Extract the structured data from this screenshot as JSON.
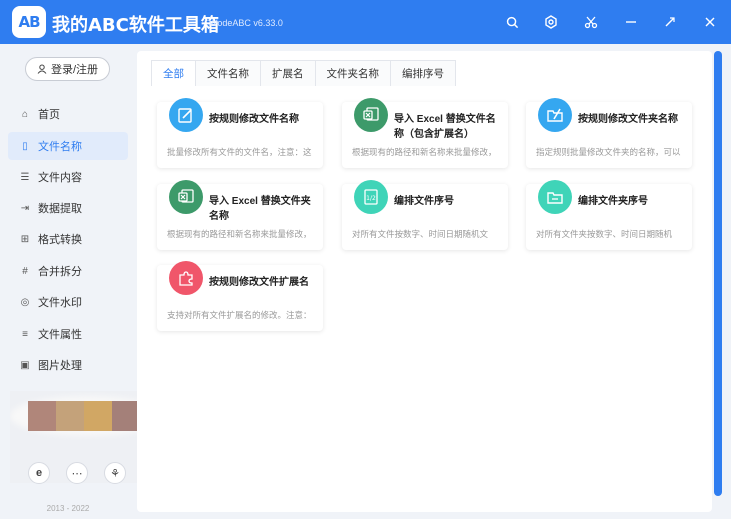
{
  "app": {
    "logo": "AB",
    "title": "我的ABC软件工具箱",
    "version": "WodeABC v6.33.0",
    "copyright": "2013 - 2022"
  },
  "titlebar_buttons": [
    "search-icon",
    "settings-icon",
    "scissors-icon",
    "minimize-icon",
    "restore-icon",
    "close-icon"
  ],
  "sidebar": {
    "login_label": "登录/注册",
    "items": [
      {
        "label": "首页",
        "icon": "home-icon"
      },
      {
        "label": "文件名称",
        "icon": "file-icon"
      },
      {
        "label": "文件内容",
        "icon": "list-icon"
      },
      {
        "label": "数据提取",
        "icon": "extract-icon"
      },
      {
        "label": "格式转换",
        "icon": "convert-icon"
      },
      {
        "label": "合并拆分",
        "icon": "hash-icon"
      },
      {
        "label": "文件水印",
        "icon": "watermark-icon"
      },
      {
        "label": "文件属性",
        "icon": "properties-icon"
      },
      {
        "label": "图片处理",
        "icon": "image-icon"
      }
    ],
    "bottom_icons": [
      "ie-icon",
      "chat-icon",
      "share-icon"
    ]
  },
  "tabs": [
    "全部",
    "文件名称",
    "扩展名",
    "文件夹名称",
    "编排序号"
  ],
  "cards": [
    {
      "title": "按规则修改文件名称",
      "desc": "批量修改所有文件的文件名，注意：这",
      "color": "#35a7f0",
      "icon": "edit-icon"
    },
    {
      "title": "导入 Excel 替换文件名称（包含扩展名）",
      "desc": "根据现有的路径和新名称来批量修改，",
      "color": "#3d9a6a",
      "icon": "excel-icon"
    },
    {
      "title": "按规则修改文件夹名称",
      "desc": "指定规则批量修改文件夹的名称，可以",
      "color": "#35a7f0",
      "icon": "folder-edit-icon"
    },
    {
      "title": "导入 Excel 替换文件夹名称",
      "desc": "根据现有的路径和新名称来批量修改，",
      "color": "#3d9a6a",
      "icon": "excel-icon"
    },
    {
      "title": "编排文件序号",
      "desc": "对所有文件按数字、时间日期随机文",
      "color": "#3fd4b8",
      "icon": "numbering-icon"
    },
    {
      "title": "编排文件夹序号",
      "desc": "对所有文件夹按数字、时间日期随机",
      "color": "#3fd4b8",
      "icon": "folder-numbering-icon"
    },
    {
      "title": "按规则修改文件扩展名",
      "desc": "支持对所有文件扩展名的修改。注意：",
      "color": "#f0566a",
      "icon": "puzzle-icon"
    }
  ]
}
